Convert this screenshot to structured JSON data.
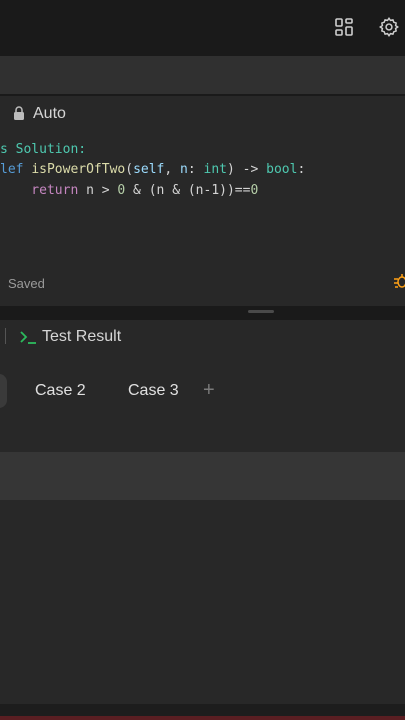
{
  "topbar": {
    "icons": [
      "layout-icon",
      "gear-icon"
    ]
  },
  "editor": {
    "language_mode": "Auto",
    "lines": [
      [
        {
          "t": "s Solution:",
          "c": "#4ec9b0"
        }
      ],
      [
        {
          "t": "lef ",
          "c": "#569cd6"
        },
        {
          "t": "isPowerOfTwo",
          "c": "#dcdcaa"
        },
        {
          "t": "(",
          "c": "#d4d4d4"
        },
        {
          "t": "self",
          "c": "#9cdcfe"
        },
        {
          "t": ", ",
          "c": "#d4d4d4"
        },
        {
          "t": "n",
          "c": "#9cdcfe"
        },
        {
          "t": ": ",
          "c": "#d4d4d4"
        },
        {
          "t": "int",
          "c": "#4ec9b0"
        },
        {
          "t": ") -> ",
          "c": "#d4d4d4"
        },
        {
          "t": "bool",
          "c": "#4ec9b0"
        },
        {
          "t": ":",
          "c": "#d4d4d4"
        }
      ],
      [
        {
          "t": "    return ",
          "c": "#c586c0"
        },
        {
          "t": "n > ",
          "c": "#d4d4d4"
        },
        {
          "t": "0",
          "c": "#b5cea8"
        },
        {
          "t": " & (n & (n-1))==",
          "c": "#d4d4d4"
        },
        {
          "t": "0",
          "c": "#b5cea8"
        }
      ]
    ],
    "status": "Saved"
  },
  "test_panel": {
    "tab_label": "Test Result",
    "cases": [
      "Case 2",
      "Case 3"
    ],
    "add_label": "+"
  },
  "colors": {
    "accent_green": "#2cbb5d",
    "bug_yellow": "#ffa116"
  }
}
